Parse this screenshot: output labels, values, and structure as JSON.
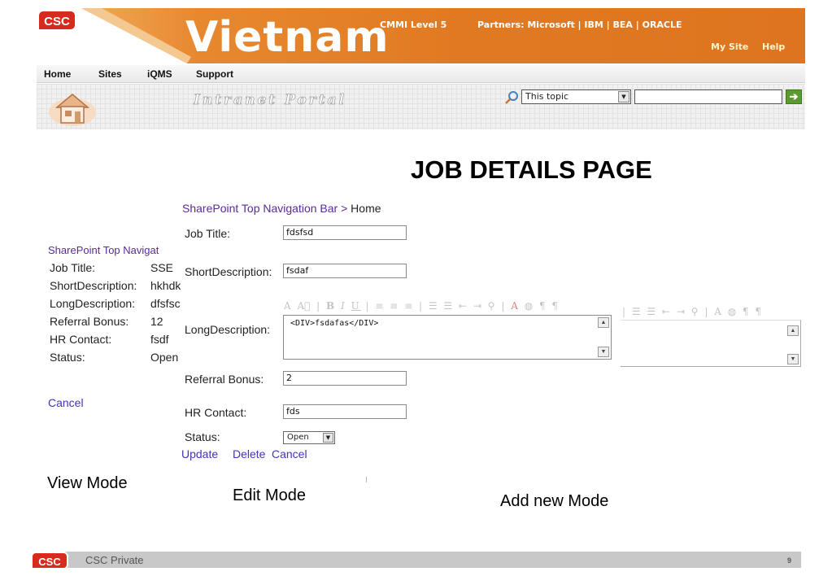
{
  "header": {
    "logo": "CSC",
    "title": "Vietnam",
    "cmmi": "CMMI Level 5",
    "partners": "Partners: Microsoft  |  IBM  |  BEA  |  ORACLE",
    "my_site": "My Site",
    "help": "Help"
  },
  "nav": {
    "items": [
      "Home",
      "Sites",
      "iQMS",
      "Support"
    ]
  },
  "portal": {
    "title": "Intranet Portal",
    "search_scope": "This topic",
    "search_value": ""
  },
  "page_heading": "JOB DETAILS PAGE",
  "view_mode": {
    "breadcrumb": "SharePoint Top Navigat",
    "fields": [
      {
        "label": "Job Title:",
        "value": "SSE"
      },
      {
        "label": "ShortDescription:",
        "value": "hkhdk"
      },
      {
        "label": "LongDescription:",
        "value": "dfsfsc"
      },
      {
        "label": "Referral Bonus:",
        "value": "12"
      },
      {
        "label": "HR Contact:",
        "value": "fsdf"
      },
      {
        "label": "Status:",
        "value": "Open"
      }
    ],
    "cancel": "Cancel",
    "caption": "View Mode"
  },
  "edit_mode": {
    "breadcrumb_link": "SharePoint Top Navigation Bar",
    "breadcrumb_sep": " > ",
    "breadcrumb_current": "Home",
    "job_title_label": "Job Title:",
    "job_title_value": "fdsfsd",
    "short_desc_label": "ShortDescription:",
    "short_desc_value": "fsdaf",
    "long_desc_label": "LongDescription:",
    "long_desc_value": "<DIV>fsdafas</DIV>",
    "referral_label": "Referral Bonus:",
    "referral_value": "2",
    "hr_label": "HR Contact:",
    "hr_value": "fds",
    "status_label": "Status:",
    "status_value": "Open",
    "update": "Update",
    "delete": "Delete",
    "cancel": "Cancel",
    "caption": "Edit Mode"
  },
  "add_mode": {
    "caption": "Add new Mode"
  },
  "footer": {
    "logo": "CSC",
    "text": "CSC Private",
    "page": "9"
  }
}
